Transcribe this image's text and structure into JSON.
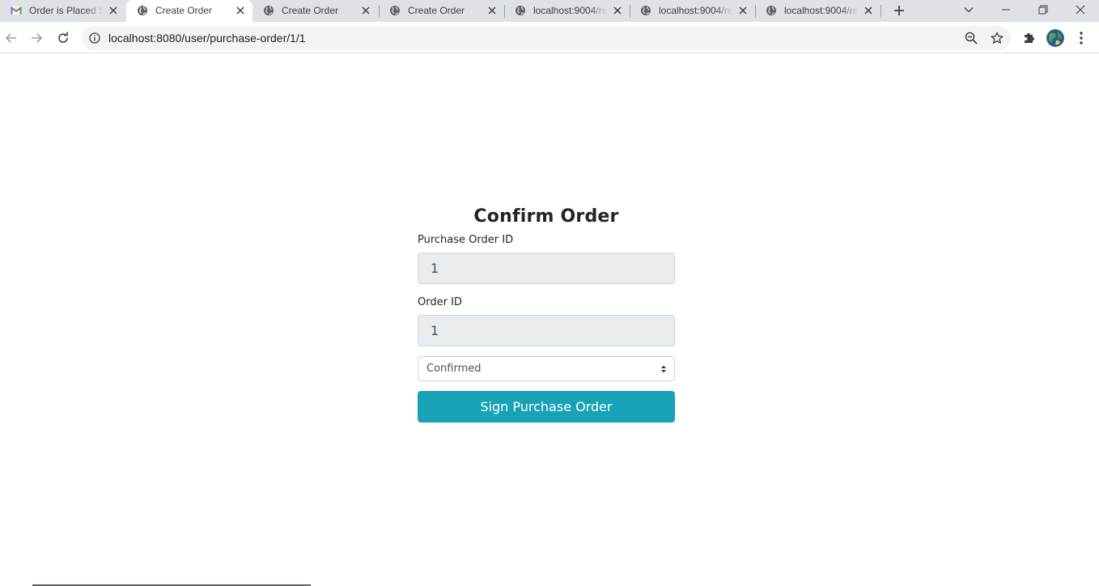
{
  "browser": {
    "tabs": [
      {
        "title": "Order is Placed S",
        "favicon": "gmail-icon",
        "active": false
      },
      {
        "title": "Create Order",
        "favicon": "globe-icon",
        "active": true
      },
      {
        "title": "Create Order",
        "favicon": "globe-icon",
        "active": false
      },
      {
        "title": "Create Order",
        "favicon": "globe-icon",
        "active": false
      },
      {
        "title": "localhost:9004/re",
        "favicon": "globe-icon",
        "active": false
      },
      {
        "title": "localhost:9004/re",
        "favicon": "globe-icon",
        "active": false
      },
      {
        "title": "localhost:9004/re",
        "favicon": "globe-icon",
        "active": false
      }
    ],
    "url": "localhost:8080/user/purchase-order/1/1"
  },
  "form": {
    "title": "Confirm Order",
    "purchase_order_label": "Purchase Order ID",
    "purchase_order_value": "1",
    "order_label": "Order ID",
    "order_value": "1",
    "status_selected": "Confirmed",
    "submit_label": "Sign Purchase Order"
  },
  "colors": {
    "accent": "#17a2b8",
    "input_disabled_bg": "#e9ecef",
    "tabstrip_bg": "#dee1e6"
  }
}
